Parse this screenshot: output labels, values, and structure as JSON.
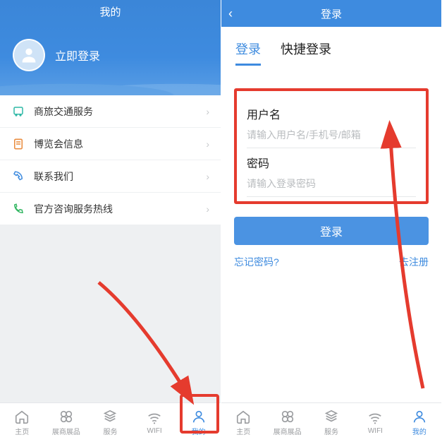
{
  "left": {
    "header_title": "我的",
    "login_cta": "立即登录",
    "menu": [
      {
        "icon": "bus",
        "color": "#2fb8a6",
        "label": "商旅交通服务"
      },
      {
        "icon": "doc",
        "color": "#e98a3b",
        "label": "博览会信息"
      },
      {
        "icon": "phone",
        "color": "#3e8bdf",
        "label": "联系我们"
      },
      {
        "icon": "call",
        "color": "#35b764",
        "label": "官方咨询服务热线"
      }
    ]
  },
  "right": {
    "header_title": "登录",
    "tabs": {
      "login": "登录",
      "quick": "快捷登录"
    },
    "username_label": "用户名",
    "username_placeholder": "请输入用户名/手机号/邮箱",
    "password_label": "密码",
    "password_placeholder": "请输入登录密码",
    "login_button": "登录",
    "forgot": "忘记密码?",
    "register": "去注册"
  },
  "tabbar": [
    {
      "key": "home",
      "label": "主页"
    },
    {
      "key": "exhibit",
      "label": "展商展品"
    },
    {
      "key": "service",
      "label": "服务"
    },
    {
      "key": "wifi",
      "label": "WIFI"
    },
    {
      "key": "mine",
      "label": "我的"
    }
  ],
  "colors": {
    "accent": "#3e8bdf",
    "annotation": "#e53b2e"
  }
}
